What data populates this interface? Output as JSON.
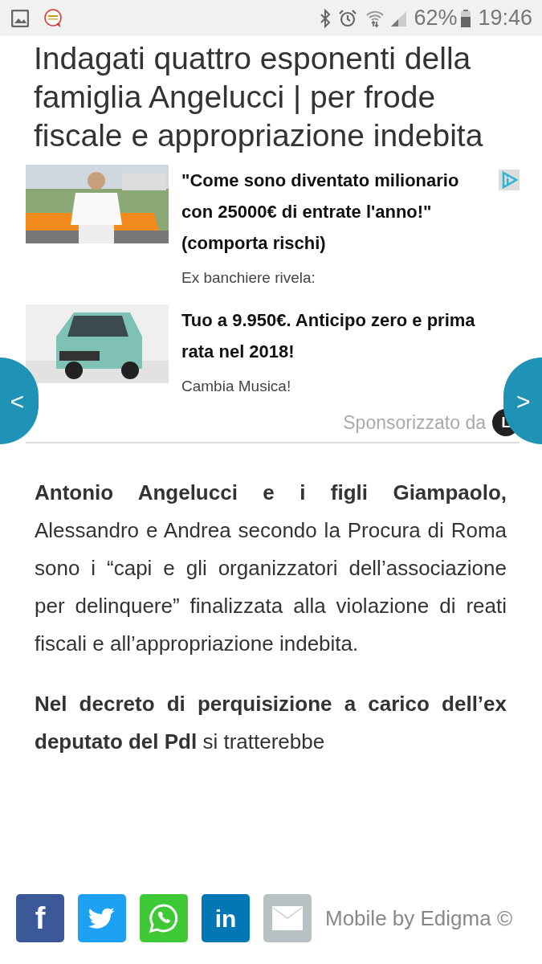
{
  "status_bar": {
    "battery": "62%",
    "time": "19:46"
  },
  "headline": "Indagati quattro esponenti della famiglia Angelucci | per frode fiscale e appropriazione indebita",
  "ads": [
    {
      "title": "\"Come sono diventato milionario con 25000€ di entrate l'anno!\" (comporta rischi)",
      "source": "Ex banchiere rivela:",
      "kind": "person",
      "adchoices": true
    },
    {
      "title": "Tuo a 9.950€. Anticipo zero e prima rata nel 2018!",
      "source": "Cambia Musica!",
      "kind": "car",
      "adchoices": false
    }
  ],
  "carousel": {
    "prev": "<",
    "next": ">"
  },
  "sponsor": {
    "text": "Sponsorizzato da",
    "logo": "L"
  },
  "paragraphs": [
    "**Antonio Angelucci e i figli Giampaolo,** Alessandro e Andrea secondo la Procura di Roma sono i “capi e gli organizzatori dell’associazione per delinquere” finalizzata alla violazione di reati fiscali e all’appropriazione indebita.",
    "**Nel decreto di perquisizione a carico dell’ex deputato del Pdl** si tratterebbe"
  ],
  "share_buttons": [
    {
      "kind": "facebook",
      "label": "f"
    },
    {
      "kind": "twitter"
    },
    {
      "kind": "whatsapp"
    },
    {
      "kind": "linkedin",
      "label": "in"
    },
    {
      "kind": "email"
    }
  ],
  "credit": "Mobile by Edigma ©"
}
